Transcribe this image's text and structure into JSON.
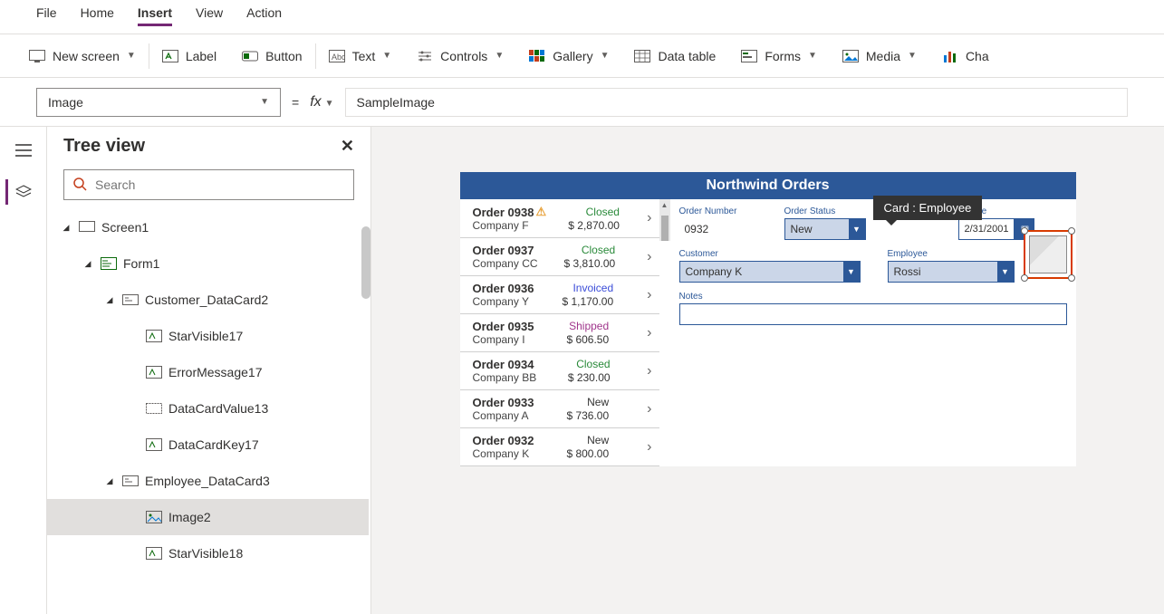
{
  "menu": {
    "file": "File",
    "home": "Home",
    "insert": "Insert",
    "view": "View",
    "action": "Action"
  },
  "ribbon": {
    "newscreen": "New screen",
    "label": "Label",
    "button": "Button",
    "text": "Text",
    "controls": "Controls",
    "gallery": "Gallery",
    "datatable": "Data table",
    "forms": "Forms",
    "media": "Media",
    "charts": "Cha"
  },
  "formula": {
    "property": "Image",
    "equals": "=",
    "fx": "fx",
    "value": "SampleImage"
  },
  "tree": {
    "title": "Tree view",
    "search_placeholder": "Search",
    "nodes": {
      "screen1": "Screen1",
      "form1": "Form1",
      "customer_dc": "Customer_DataCard2",
      "starvisible17": "StarVisible17",
      "errormessage17": "ErrorMessage17",
      "datacardvalue13": "DataCardValue13",
      "datacardkey17": "DataCardKey17",
      "employee_dc": "Employee_DataCard3",
      "image2": "Image2",
      "starvisible18": "StarVisible18"
    }
  },
  "app": {
    "title": "Northwind Orders",
    "orders": [
      {
        "num": "Order 0938",
        "company": "Company F",
        "status": "Closed",
        "status_cls": "st-closed",
        "amount": "$ 2,870.00",
        "warn": true
      },
      {
        "num": "Order 0937",
        "company": "Company CC",
        "status": "Closed",
        "status_cls": "st-closed",
        "amount": "$ 3,810.00"
      },
      {
        "num": "Order 0936",
        "company": "Company Y",
        "status": "Invoiced",
        "status_cls": "st-invoiced",
        "amount": "$ 1,170.00"
      },
      {
        "num": "Order 0935",
        "company": "Company I",
        "status": "Shipped",
        "status_cls": "st-shipped",
        "amount": "$ 606.50"
      },
      {
        "num": "Order 0934",
        "company": "Company BB",
        "status": "Closed",
        "status_cls": "st-closed",
        "amount": "$ 230.00"
      },
      {
        "num": "Order 0933",
        "company": "Company A",
        "status": "New",
        "status_cls": "st-new",
        "amount": "$ 736.00"
      },
      {
        "num": "Order 0932",
        "company": "Company K",
        "status": "New",
        "status_cls": "st-new",
        "amount": "$ 800.00"
      }
    ],
    "detail": {
      "order_number_label": "Order Number",
      "order_number": "0932",
      "order_status_label": "Order Status",
      "order_status": "New",
      "paid_date_label": "id Date",
      "paid_date": "2/31/2001",
      "customer_label": "Customer",
      "customer": "Company K",
      "employee_label": "Employee",
      "employee": "Rossi",
      "notes_label": "Notes",
      "tooltip": "Card : Employee"
    }
  }
}
